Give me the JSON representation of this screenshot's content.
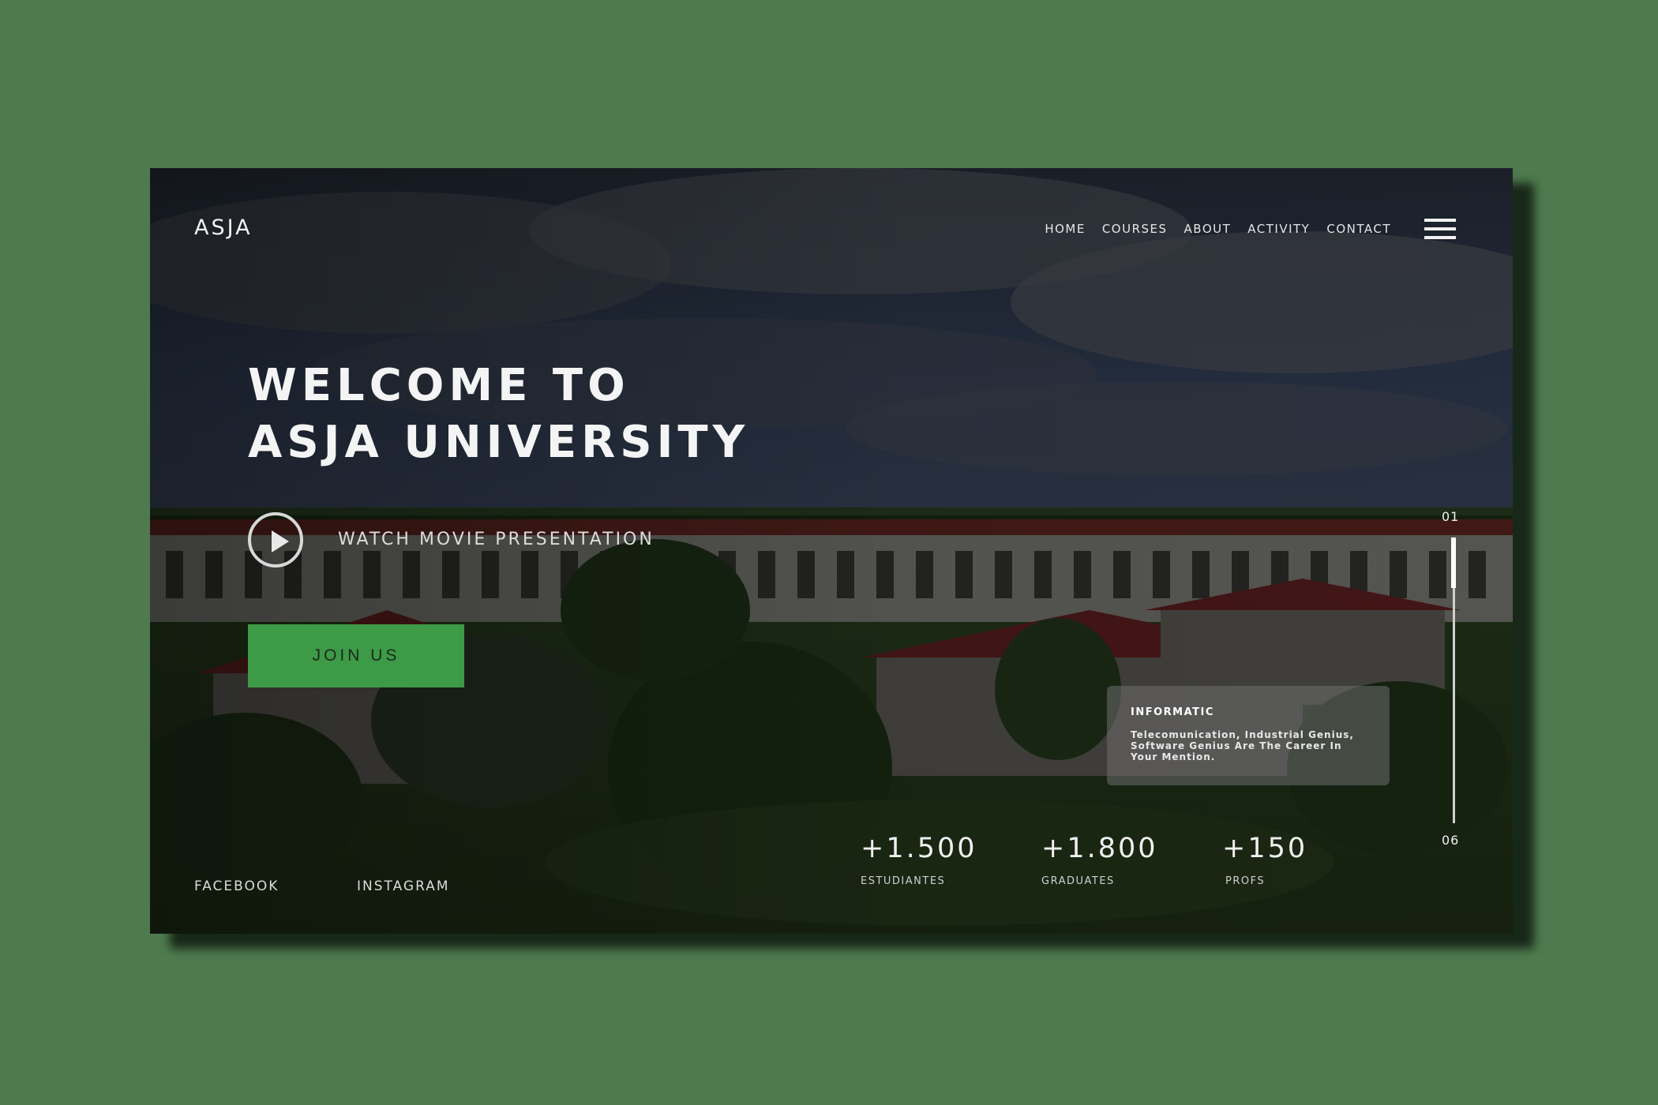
{
  "brand": {
    "logo": "ASJA"
  },
  "nav": {
    "items": [
      "HOME",
      "COURSES",
      "ABOUT",
      "ACTIVITY",
      "CONTACT"
    ],
    "menu_icon": "hamburger-icon"
  },
  "hero": {
    "title_line1": "WELCOME TO",
    "title_line2": "ASJA UNIVERSITY",
    "watch_label": "WATCH MOVIE PRESENTATION",
    "play_icon": "play-icon",
    "cta_label": "JOIN US"
  },
  "info_card": {
    "title": "INFORMATIC",
    "text": "Telecomunication, Industrial Genius, Software Genius Are The Career In Your Mention."
  },
  "stats": [
    {
      "value": "+1.500",
      "label": "ESTUDIANTES"
    },
    {
      "value": "+1.800",
      "label": "GRADUATES"
    },
    {
      "value": "+150",
      "label": "PROFS"
    }
  ],
  "social": {
    "facebook": "FACEBOOK",
    "instagram": "INSTAGRAM"
  },
  "pager": {
    "current": "01",
    "total": "06"
  },
  "colors": {
    "accent": "#3d9a47",
    "page_bg": "#4f7a4f"
  }
}
